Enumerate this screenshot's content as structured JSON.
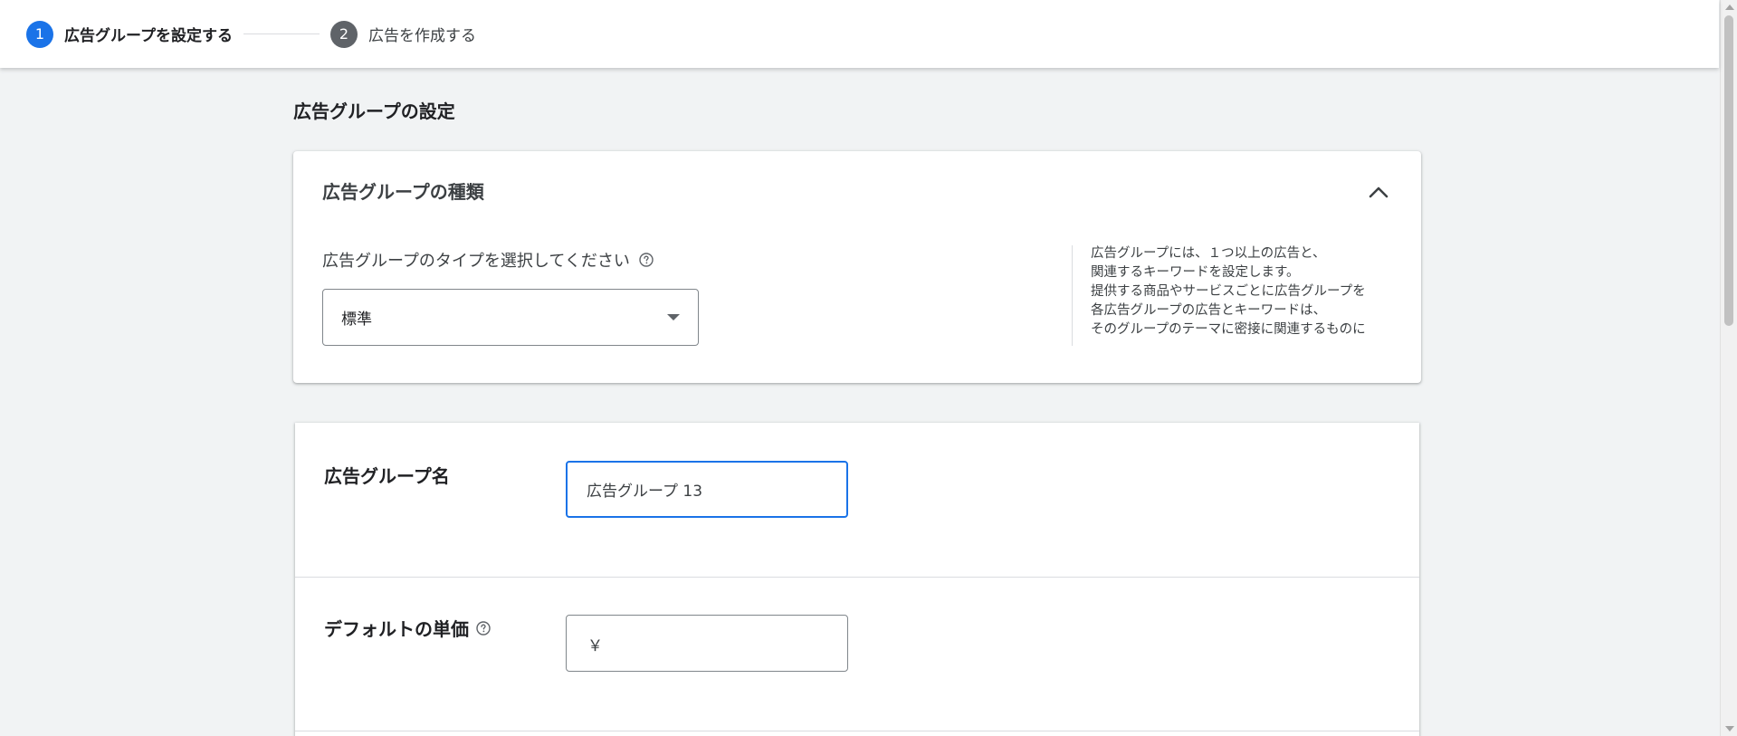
{
  "stepper": {
    "steps": [
      {
        "number": "1",
        "label": "広告グループを設定する",
        "state": "active"
      },
      {
        "number": "2",
        "label": "広告を作成する",
        "state": "inactive"
      }
    ]
  },
  "page": {
    "title": "広告グループの設定"
  },
  "ad_group_type_card": {
    "title": "広告グループの種類",
    "select_label": "広告グループのタイプを選択してください",
    "select_value": "標準",
    "info_lines": [
      "広告グループには、１つ以上の広告と、",
      "関連するキーワードを設定します。",
      "提供する商品やサービスごとに広告グループを",
      "各広告グループの広告とキーワードは、",
      "そのグループのテーマに密接に関連するものに"
    ]
  },
  "ad_group_settings_card": {
    "name_label": "広告グループ名",
    "name_value": "広告グループ 13",
    "default_bid_label": "デフォルトの単価",
    "currency_symbol": "￥",
    "default_bid_value": ""
  },
  "colors": {
    "accent": "#1a73e8",
    "inactive_step": "#5f6368",
    "background": "#f1f3f4"
  },
  "icons": {
    "collapse": "chevron-up-icon",
    "help": "help-circle-icon",
    "dropdown": "dropdown-arrow-icon"
  }
}
